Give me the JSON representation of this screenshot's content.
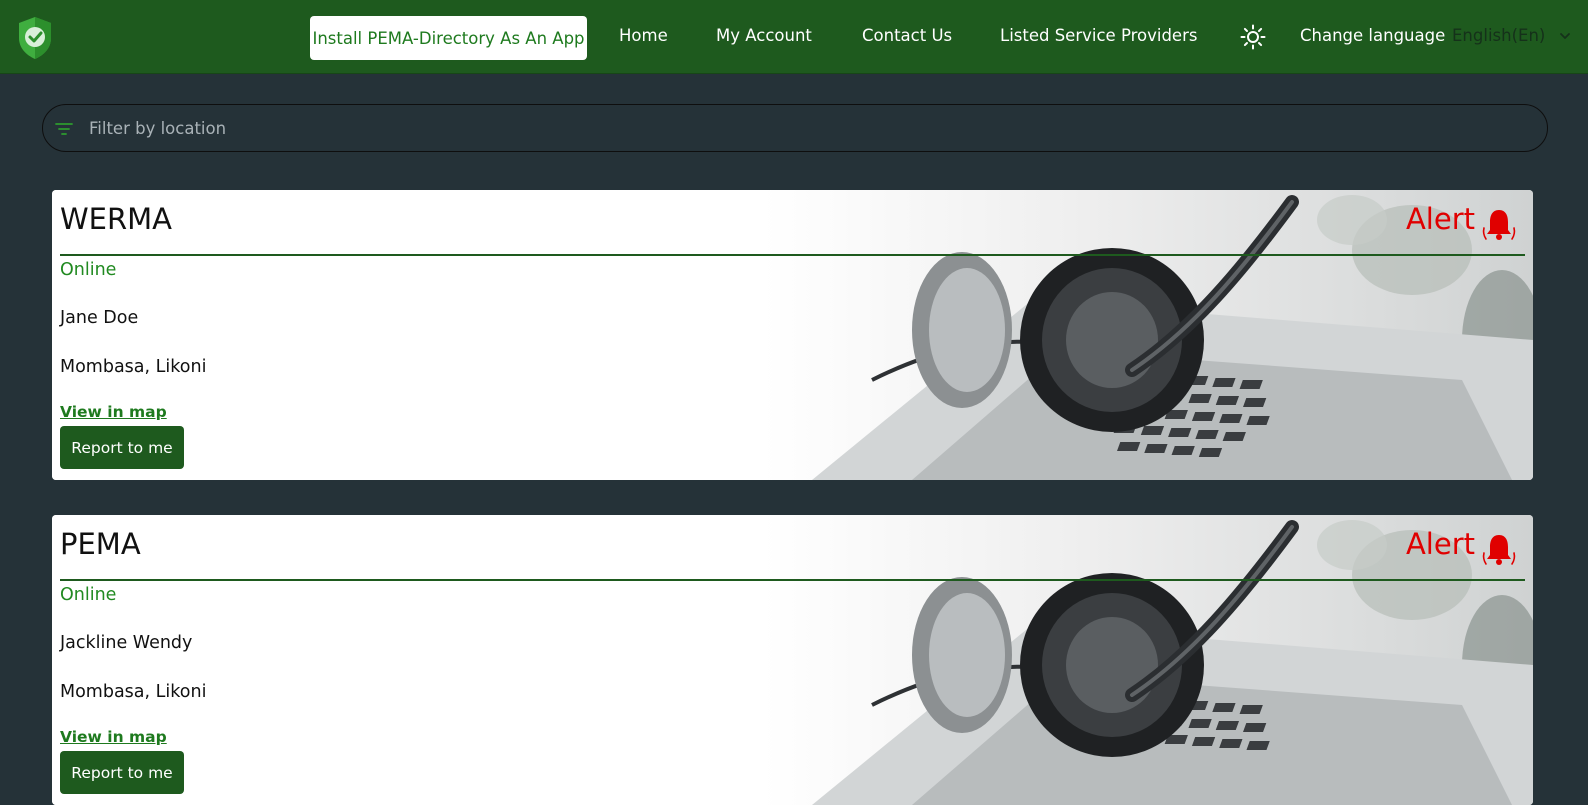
{
  "navbar": {
    "logo_icon": "shield-check-icon",
    "install_label": "Install PEMA-Directory As An App",
    "links": [
      {
        "label": "Home"
      },
      {
        "label": "My Account"
      },
      {
        "label": "Contact Us"
      },
      {
        "label": "Listed Service Providers"
      }
    ],
    "theme_icon": "sun-icon",
    "change_language_label": "Change language",
    "language_selected": "English(En)",
    "colors": {
      "bar": "#1e5a1e",
      "install_text": "#1e7a1e"
    }
  },
  "filter": {
    "placeholder": "Filter by location",
    "icon": "filter-icon"
  },
  "cards": [
    {
      "title": "WERMA",
      "alert_label": "Alert",
      "status": "Online",
      "person": "Jane Doe",
      "location": "Mombasa, Likoni",
      "map_link": "View in map",
      "report_label": "Report to me"
    },
    {
      "title": "PEMA",
      "alert_label": "Alert",
      "status": "Online",
      "person": "Jackline Wendy",
      "location": "Mombasa, Likoni",
      "map_link": "View in map",
      "report_label": "Report to me"
    }
  ],
  "colors": {
    "page_bg": "#253238",
    "alert": "#e00000",
    "status_online": "#218a21",
    "button": "#1e5a1e"
  }
}
